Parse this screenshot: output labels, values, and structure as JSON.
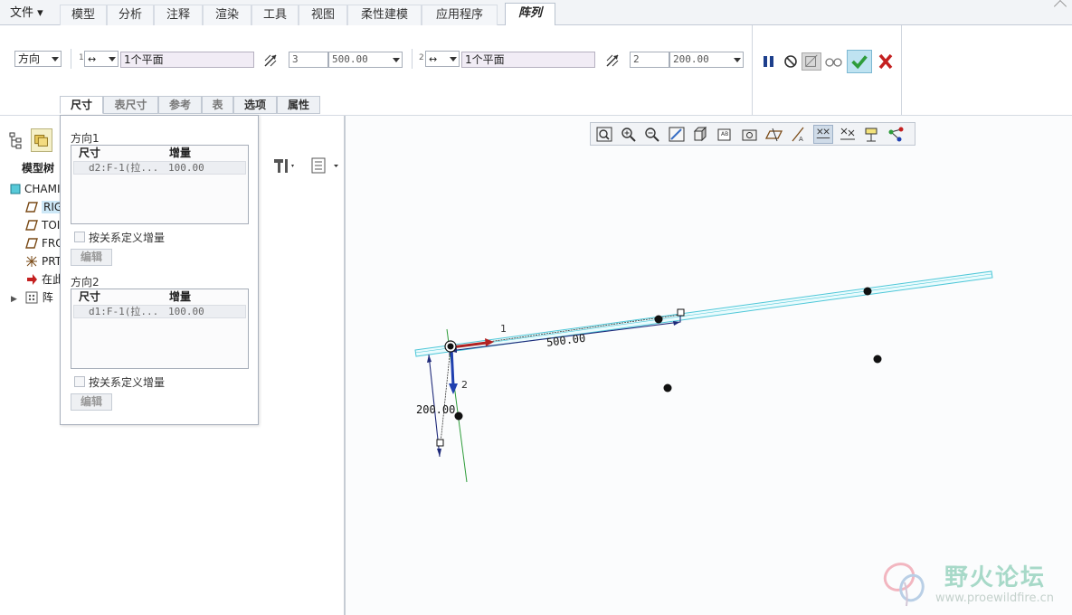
{
  "ribbon": {
    "file_menu": "文件",
    "tabs": [
      "模型",
      "分析",
      "注释",
      "渲染",
      "工具",
      "视图",
      "柔性建模",
      "应用程序",
      "阵列"
    ],
    "active_tab": "阵列",
    "pattern_type": "方向",
    "direction1": {
      "index": "1",
      "reference": "1个平面",
      "count": "3",
      "spacing": "500.00"
    },
    "direction2": {
      "index": "2",
      "reference": "1个平面",
      "count": "2",
      "spacing": "200.00"
    },
    "subtabs": [
      "尺寸",
      "表尺寸",
      "参考",
      "表",
      "选项",
      "属性"
    ],
    "active_subtab": "尺寸"
  },
  "popup": {
    "dir1_title": "方向1",
    "dir2_title": "方向2",
    "col_dim": "尺寸",
    "col_inc": "增量",
    "dir1_rows": [
      {
        "dim": "d2:F-1(拉...",
        "inc": "100.00"
      }
    ],
    "dir2_rows": [
      {
        "dim": "d1:F-1(拉...",
        "inc": "100.00"
      }
    ],
    "relation_label": "按关系定义增量",
    "edit_label": "编辑"
  },
  "model_tree": {
    "title": "模型树",
    "items": [
      {
        "label": "CHAMI",
        "icon": "part-icon"
      },
      {
        "label": "RIG",
        "icon": "datum-plane-icon",
        "selected": true
      },
      {
        "label": "TOI",
        "icon": "datum-plane-icon"
      },
      {
        "label": "FRO",
        "icon": "datum-plane-icon"
      },
      {
        "label": "PRT",
        "icon": "coordinate-system-icon"
      },
      {
        "label": "在此",
        "icon": "insert-here-arrow-icon"
      },
      {
        "label": "阵",
        "icon": "pattern-feature-icon"
      }
    ]
  },
  "canvas": {
    "dim1": "500.00",
    "dim2": "200.00",
    "dir1_label": "1",
    "dir2_label": "2"
  },
  "watermark": {
    "title": "野火论坛",
    "url": "www.proewildfire.cn"
  },
  "colors": {
    "accent_green": "#2e9c3a",
    "cancel_red": "#c42020",
    "plane_cyan": "#4fc7d8",
    "arrow_red": "#b22222",
    "arrow_blue": "#2040b0"
  }
}
